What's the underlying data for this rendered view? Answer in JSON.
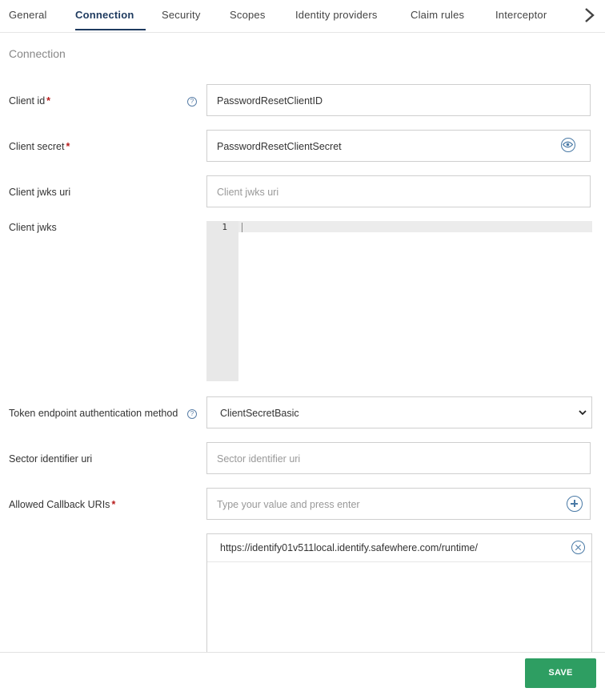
{
  "tabs": [
    {
      "label": "General"
    },
    {
      "label": "Connection",
      "active": true
    },
    {
      "label": "Security"
    },
    {
      "label": "Scopes"
    },
    {
      "label": "Identity providers"
    },
    {
      "label": "Claim rules"
    },
    {
      "label": "Interceptor"
    }
  ],
  "section_title": "Connection",
  "fields": {
    "client_id": {
      "label": "Client id",
      "required_mark": "*",
      "value": "PasswordResetClientID",
      "help": "?"
    },
    "client_secret": {
      "label": "Client secret",
      "required_mark": "*",
      "value": "PasswordResetClientSecret"
    },
    "client_jwks_uri": {
      "label": "Client jwks uri",
      "placeholder": "Client jwks uri"
    },
    "client_jwks": {
      "label": "Client jwks",
      "line_number": "1"
    },
    "token_auth_method": {
      "label": "Token endpoint authentication method",
      "help": "?",
      "selected": "ClientSecretBasic"
    },
    "sector_identifier_uri": {
      "label": "Sector identifier uri",
      "placeholder": "Sector identifier uri"
    },
    "allowed_callback_uris": {
      "label": "Allowed Callback URIs",
      "required_mark": "*",
      "placeholder": "Type your value and press enter",
      "items": [
        "https://identify01v511local.identify.safewhere.com/runtime/"
      ]
    }
  },
  "footer": {
    "save_label": "SAVE"
  },
  "colors": {
    "accent": "#1e3a5f",
    "save": "#2e9e62",
    "required": "#b71c1c",
    "icon": "#4a7aa6"
  }
}
